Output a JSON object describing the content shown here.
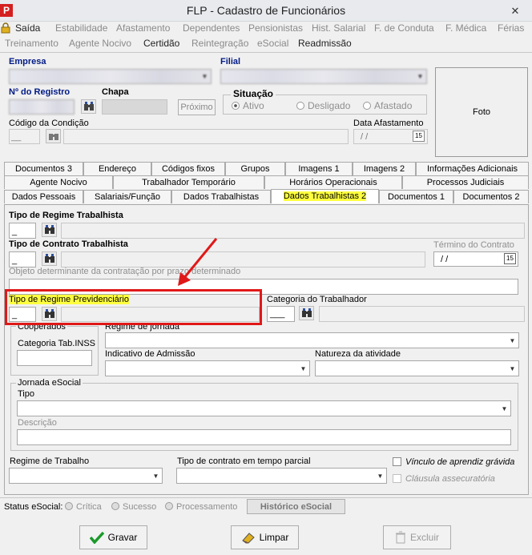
{
  "window": {
    "title": "FLP - Cadastro de Funcionários",
    "close_glyph": "✕"
  },
  "menu": {
    "row1": [
      "Saída",
      "Estabilidade",
      "Afastamento",
      "Dependentes",
      "Pensionistas",
      "Hist. Salarial",
      "F. de Conduta",
      "F. Médica",
      "Férias"
    ],
    "row2": [
      "Treinamento",
      "Agente Nocivo",
      "Certidão",
      "Reintegração",
      "eSocial",
      "Readmissão"
    ]
  },
  "header": {
    "empresa_label": "Empresa",
    "filial_label": "Filial",
    "registro_label": "Nº do Registro",
    "chapa_label": "Chapa",
    "proximo_button": "Próximo",
    "situacao_label": "Situação",
    "situacao_options": [
      "Ativo",
      "Desligado",
      "Afastado"
    ],
    "situacao_selected": "Ativo",
    "codigo_condicao_label": "Código da Condição",
    "codigo_condicao_value": "__",
    "data_afastamento_label": "Data Afastamento",
    "data_afastamento_value": "/ /",
    "foto_label": "Foto",
    "calendar_glyph": "15"
  },
  "tabs": {
    "row1": [
      "Documentos 3",
      "Endereço",
      "Códigos fixos",
      "Grupos",
      "Imagens 1",
      "Imagens 2",
      "Informações Adicionais"
    ],
    "row2": [
      "Agente Nocivo",
      "Trabalhador Temporário",
      "Horários Operacionais",
      "Processos Judiciais"
    ],
    "row3": [
      "Dados Pessoais",
      "Salariais/Função",
      "Dados Trabalhistas",
      "Dados Trabalhistas 2",
      "Documentos 1",
      "Documentos 2"
    ],
    "active": "Dados Trabalhistas 2"
  },
  "form": {
    "tipo_regime_trabalhista_label": "Tipo de Regime Trabalhista",
    "tipo_regime_trabalhista_value": "_",
    "tipo_contrato_label": "Tipo de Contrato Trabalhista",
    "tipo_contrato_value": "_",
    "termino_contrato_label": "Término do Contrato",
    "termino_contrato_value": "/ /",
    "objeto_label": "Objeto determinante da contratação por prazo determinado",
    "tipo_regime_previdenciario_label": "Tipo de Regime Previdenciário",
    "tipo_regime_previdenciario_value": "_",
    "categoria_trabalhador_label": "Categoria do Trabalhador",
    "categoria_trabalhador_value": "___",
    "cooperados_label": "Cooperados",
    "categoria_inss_label": "Categoria Tab.INSS",
    "regime_jornada_label": "Regime de jornada",
    "indicativo_admissao_label": "Indicativo de Admissão",
    "natureza_atividade_label": "Natureza da atividade",
    "jornada_esocial_label": "Jornada eSocial",
    "tipo_label": "Tipo",
    "descricao_label": "Descrição",
    "regime_trabalho_label": "Regime de Trabalho",
    "tipo_contrato_parcial_label": "Tipo de contrato em tempo parcial",
    "vinculo_aprendiz_label": "Vínculo de aprendiz grávida",
    "clausula_label": "Cláusula assecuratória"
  },
  "status": {
    "label": "Status eSocial:",
    "options": [
      "Crítica",
      "Sucesso",
      "Processamento"
    ],
    "historico_button": "Histórico eSocial"
  },
  "actions": {
    "gravar": "Gravar",
    "limpar": "Limpar",
    "excluir": "Excluir"
  },
  "colors": {
    "highlight": "#ffff40",
    "annotation": "#e01818",
    "label_blue": "#001a84"
  }
}
